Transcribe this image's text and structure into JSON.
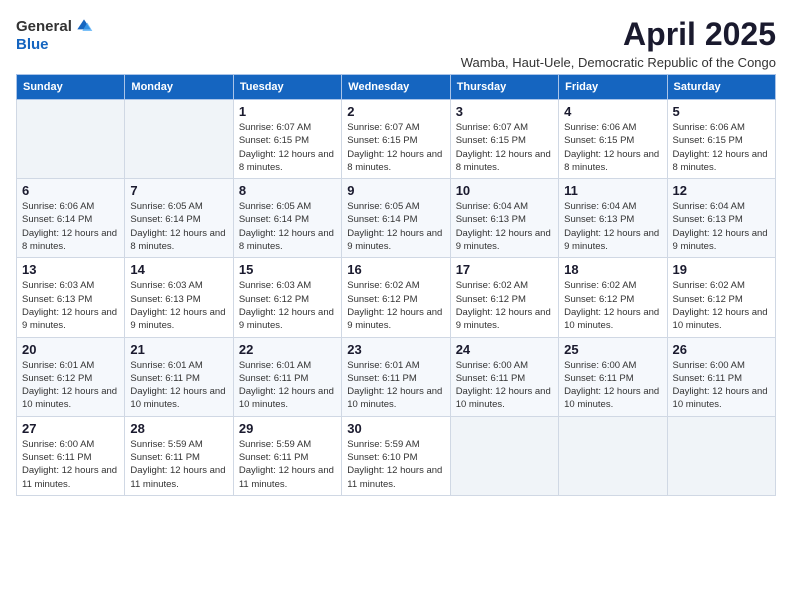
{
  "logo": {
    "general": "General",
    "blue": "Blue"
  },
  "header": {
    "month_title": "April 2025",
    "location": "Wamba, Haut-Uele, Democratic Republic of the Congo"
  },
  "weekdays": [
    "Sunday",
    "Monday",
    "Tuesday",
    "Wednesday",
    "Thursday",
    "Friday",
    "Saturday"
  ],
  "weeks": [
    [
      {
        "day": "",
        "info": ""
      },
      {
        "day": "",
        "info": ""
      },
      {
        "day": "1",
        "info": "Sunrise: 6:07 AM\nSunset: 6:15 PM\nDaylight: 12 hours and 8 minutes."
      },
      {
        "day": "2",
        "info": "Sunrise: 6:07 AM\nSunset: 6:15 PM\nDaylight: 12 hours and 8 minutes."
      },
      {
        "day": "3",
        "info": "Sunrise: 6:07 AM\nSunset: 6:15 PM\nDaylight: 12 hours and 8 minutes."
      },
      {
        "day": "4",
        "info": "Sunrise: 6:06 AM\nSunset: 6:15 PM\nDaylight: 12 hours and 8 minutes."
      },
      {
        "day": "5",
        "info": "Sunrise: 6:06 AM\nSunset: 6:15 PM\nDaylight: 12 hours and 8 minutes."
      }
    ],
    [
      {
        "day": "6",
        "info": "Sunrise: 6:06 AM\nSunset: 6:14 PM\nDaylight: 12 hours and 8 minutes."
      },
      {
        "day": "7",
        "info": "Sunrise: 6:05 AM\nSunset: 6:14 PM\nDaylight: 12 hours and 8 minutes."
      },
      {
        "day": "8",
        "info": "Sunrise: 6:05 AM\nSunset: 6:14 PM\nDaylight: 12 hours and 8 minutes."
      },
      {
        "day": "9",
        "info": "Sunrise: 6:05 AM\nSunset: 6:14 PM\nDaylight: 12 hours and 9 minutes."
      },
      {
        "day": "10",
        "info": "Sunrise: 6:04 AM\nSunset: 6:13 PM\nDaylight: 12 hours and 9 minutes."
      },
      {
        "day": "11",
        "info": "Sunrise: 6:04 AM\nSunset: 6:13 PM\nDaylight: 12 hours and 9 minutes."
      },
      {
        "day": "12",
        "info": "Sunrise: 6:04 AM\nSunset: 6:13 PM\nDaylight: 12 hours and 9 minutes."
      }
    ],
    [
      {
        "day": "13",
        "info": "Sunrise: 6:03 AM\nSunset: 6:13 PM\nDaylight: 12 hours and 9 minutes."
      },
      {
        "day": "14",
        "info": "Sunrise: 6:03 AM\nSunset: 6:13 PM\nDaylight: 12 hours and 9 minutes."
      },
      {
        "day": "15",
        "info": "Sunrise: 6:03 AM\nSunset: 6:12 PM\nDaylight: 12 hours and 9 minutes."
      },
      {
        "day": "16",
        "info": "Sunrise: 6:02 AM\nSunset: 6:12 PM\nDaylight: 12 hours and 9 minutes."
      },
      {
        "day": "17",
        "info": "Sunrise: 6:02 AM\nSunset: 6:12 PM\nDaylight: 12 hours and 9 minutes."
      },
      {
        "day": "18",
        "info": "Sunrise: 6:02 AM\nSunset: 6:12 PM\nDaylight: 12 hours and 10 minutes."
      },
      {
        "day": "19",
        "info": "Sunrise: 6:02 AM\nSunset: 6:12 PM\nDaylight: 12 hours and 10 minutes."
      }
    ],
    [
      {
        "day": "20",
        "info": "Sunrise: 6:01 AM\nSunset: 6:12 PM\nDaylight: 12 hours and 10 minutes."
      },
      {
        "day": "21",
        "info": "Sunrise: 6:01 AM\nSunset: 6:11 PM\nDaylight: 12 hours and 10 minutes."
      },
      {
        "day": "22",
        "info": "Sunrise: 6:01 AM\nSunset: 6:11 PM\nDaylight: 12 hours and 10 minutes."
      },
      {
        "day": "23",
        "info": "Sunrise: 6:01 AM\nSunset: 6:11 PM\nDaylight: 12 hours and 10 minutes."
      },
      {
        "day": "24",
        "info": "Sunrise: 6:00 AM\nSunset: 6:11 PM\nDaylight: 12 hours and 10 minutes."
      },
      {
        "day": "25",
        "info": "Sunrise: 6:00 AM\nSunset: 6:11 PM\nDaylight: 12 hours and 10 minutes."
      },
      {
        "day": "26",
        "info": "Sunrise: 6:00 AM\nSunset: 6:11 PM\nDaylight: 12 hours and 10 minutes."
      }
    ],
    [
      {
        "day": "27",
        "info": "Sunrise: 6:00 AM\nSunset: 6:11 PM\nDaylight: 12 hours and 11 minutes."
      },
      {
        "day": "28",
        "info": "Sunrise: 5:59 AM\nSunset: 6:11 PM\nDaylight: 12 hours and 11 minutes."
      },
      {
        "day": "29",
        "info": "Sunrise: 5:59 AM\nSunset: 6:11 PM\nDaylight: 12 hours and 11 minutes."
      },
      {
        "day": "30",
        "info": "Sunrise: 5:59 AM\nSunset: 6:10 PM\nDaylight: 12 hours and 11 minutes."
      },
      {
        "day": "",
        "info": ""
      },
      {
        "day": "",
        "info": ""
      },
      {
        "day": "",
        "info": ""
      }
    ]
  ]
}
